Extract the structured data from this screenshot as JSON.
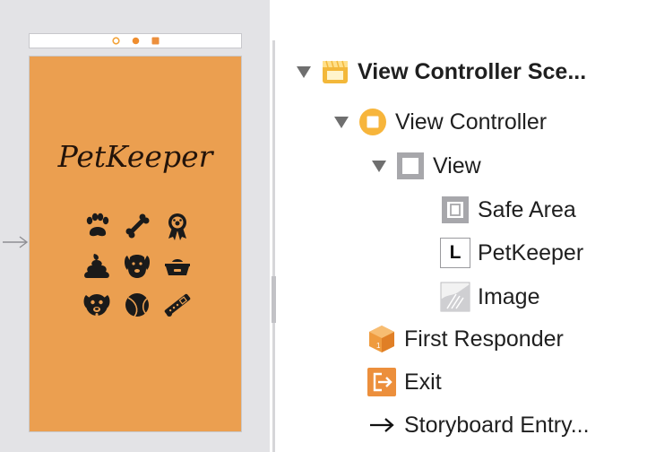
{
  "app": {
    "title": "PetKeeper"
  },
  "canvas": {
    "pet_icons": [
      "paw-icon",
      "bone-icon",
      "award-ribbon-icon",
      "dog-poop-icon",
      "dog-face-icon",
      "food-bowl-icon",
      "puppy-face-icon",
      "tennis-ball-icon",
      "dog-collar-icon"
    ],
    "background_color": "#eb9f50"
  },
  "outline": {
    "scene": "View Controller Sce...",
    "view_controller": "View Controller",
    "view": "View",
    "safe_area": "Safe Area",
    "label": "PetKeeper",
    "label_badge": "L",
    "image": "Image",
    "first_responder": "First Responder",
    "exit": "Exit",
    "storyboard_entry": "Storyboard Entry..."
  },
  "colors": {
    "scene_icon": "#f3b83a",
    "view_controller_icon": "#f7b53b",
    "first_responder_icon": "#ef9b3e",
    "exit_icon": "#ec8f3c"
  }
}
